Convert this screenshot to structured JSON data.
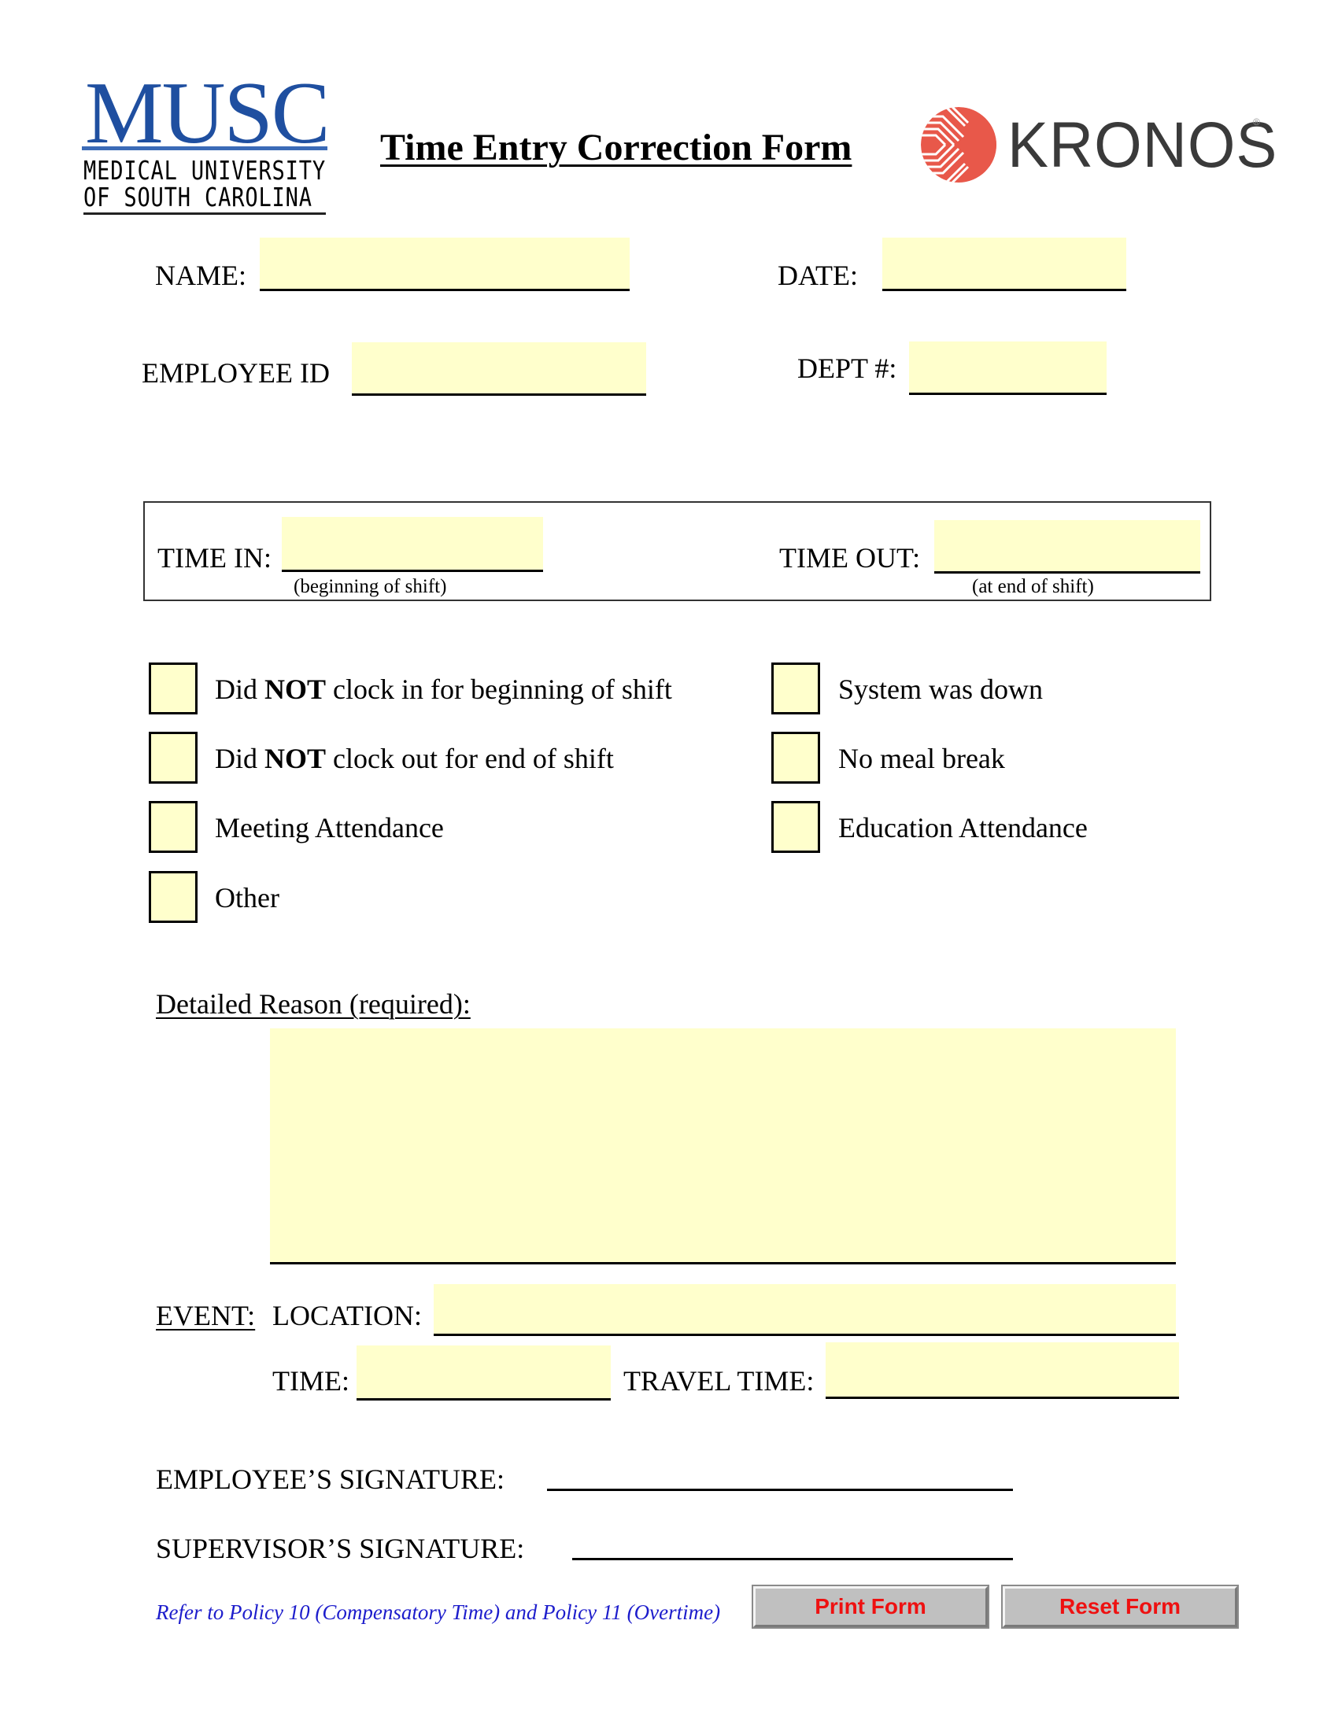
{
  "header": {
    "musc_logo": {
      "wordmark": "MUSC",
      "line1": "MEDICAL UNIVERSITY",
      "line2": "OF SOUTH CAROLINA",
      "color": "#1f4fa0"
    },
    "title": "Time Entry Correction Form",
    "kronos_logo": {
      "wordmark": "KRONOS",
      "registered": "®",
      "accent_color": "#e8584a"
    }
  },
  "fields": {
    "name": {
      "label": "NAME:",
      "value": ""
    },
    "date": {
      "label": "DATE:",
      "value": ""
    },
    "employee_id": {
      "label": "EMPLOYEE ID",
      "value": ""
    },
    "dept": {
      "label": "DEPT #:",
      "value": ""
    }
  },
  "time_box": {
    "time_in": {
      "label": "TIME IN:",
      "hint": "(beginning of shift)",
      "value": ""
    },
    "time_out": {
      "label": "TIME OUT:",
      "hint": "(at end of shift)",
      "value": ""
    }
  },
  "checkboxes": {
    "left": [
      {
        "pre": "Did ",
        "bold": "NOT",
        "post": " clock in for beginning of shift",
        "checked": false
      },
      {
        "pre": "Did ",
        "bold": "NOT",
        "post": " clock out for end of shift",
        "checked": false
      },
      {
        "pre": "Meeting Attendance",
        "bold": "",
        "post": "",
        "checked": false
      },
      {
        "pre": "Other",
        "bold": "",
        "post": "",
        "checked": false
      }
    ],
    "right": [
      {
        "label": "System was down",
        "checked": false
      },
      {
        "label": "No meal break",
        "checked": false
      },
      {
        "label": "Education Attendance",
        "checked": false
      }
    ]
  },
  "reason": {
    "label": "Detailed Reason (required):",
    "value": ""
  },
  "event": {
    "label": "EVENT:",
    "location": {
      "label": "LOCATION:",
      "value": ""
    },
    "time": {
      "label": "TIME:",
      "value": ""
    },
    "travel_time": {
      "label": "TRAVEL TIME:",
      "value": ""
    }
  },
  "signatures": {
    "employee": "EMPLOYEE’S SIGNATURE:",
    "supervisor": "SUPERVISOR’S SIGNATURE:"
  },
  "footer": {
    "policy_note": "Refer to Policy 10 (Compensatory Time) and Policy 11 (Overtime)",
    "print_label": "Print Form",
    "reset_label": "Reset Form"
  },
  "colors": {
    "field_fill": "#ffffcc",
    "button_text": "#ee1111",
    "button_face": "#c0c0c0",
    "policy_text": "#1d1dcc"
  }
}
